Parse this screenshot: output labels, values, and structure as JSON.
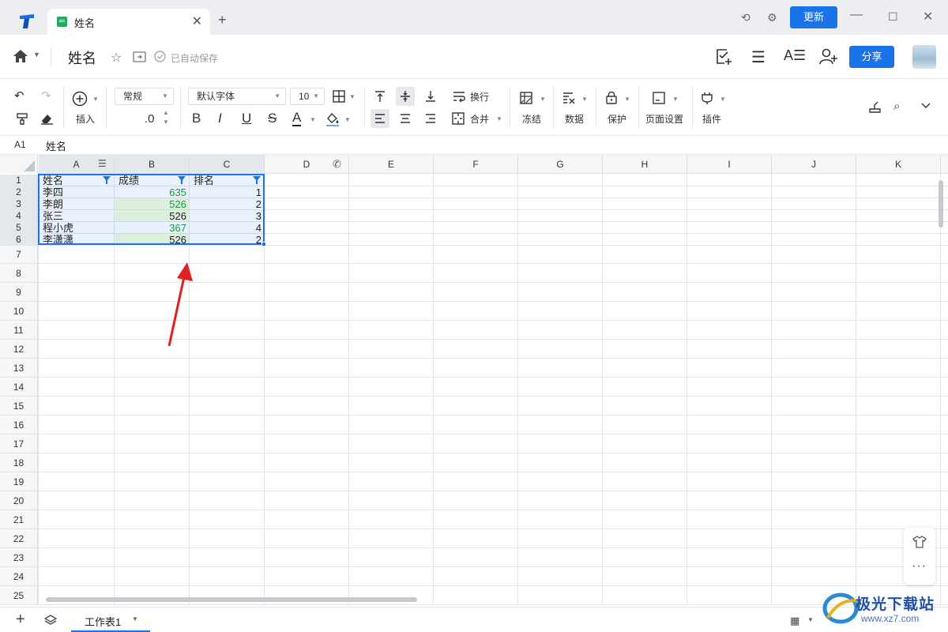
{
  "window": {
    "tab_title": "姓名",
    "update_label": "更新"
  },
  "header": {
    "doc_title": "姓名",
    "autosave": "已自动保存",
    "share_label": "分享"
  },
  "toolbar": {
    "insert_label": "插入",
    "number_format": "常规",
    "decimal_label": ".0",
    "font_name": "默认字体",
    "font_size": "10",
    "wrap_label": "换行",
    "merge_label": "合并",
    "freeze_label": "冻结",
    "data_label": "数据",
    "protect_label": "保护",
    "page_setup_label": "页面设置",
    "plugins_label": "插件",
    "bold_label": "B",
    "italic_label": "I",
    "underline_label": "U",
    "strike_label": "S",
    "font_color_label": "A"
  },
  "formula_bar": {
    "cell_ref": "A1",
    "value": "姓名"
  },
  "grid": {
    "columns": [
      "A",
      "B",
      "C",
      "D",
      "E",
      "F",
      "G",
      "H",
      "I",
      "J",
      "K"
    ],
    "rows": [
      "1",
      "2",
      "3",
      "4",
      "5",
      "6",
      "7",
      "8",
      "9",
      "10",
      "11",
      "12",
      "13",
      "14",
      "15",
      "16",
      "17",
      "18",
      "19",
      "20",
      "21",
      "22",
      "23",
      "24",
      "25"
    ],
    "table": {
      "headers": [
        "姓名",
        "成绩",
        "排名"
      ],
      "data": [
        [
          "李四",
          "635",
          "1"
        ],
        [
          "李朗",
          "526",
          "2"
        ],
        [
          "张三",
          "526",
          "3"
        ],
        [
          "程小虎",
          "367",
          "4"
        ],
        [
          "李潇潇",
          "526",
          "2"
        ]
      ],
      "highlighted_rows": [
        1,
        2,
        4
      ]
    },
    "colors": {
      "selection": "#1a73e8",
      "duplicate_fill": "#dcefdd",
      "duplicate_text": "#1a9a3a",
      "annotation_arrow": "#e02020"
    }
  },
  "sheets": {
    "active": "工作表1"
  },
  "watermark": {
    "text": "极光下载站",
    "sub": "www.xz7.com"
  },
  "icons": [
    "app-logo-icon",
    "home-icon",
    "star-icon",
    "move-icon",
    "check-circle-icon",
    "add-task-icon",
    "menu-icon",
    "text-format-icon",
    "add-user-icon",
    "undo-icon",
    "redo-icon",
    "format-painter-icon",
    "eraser-icon",
    "insert-plus-icon",
    "border-icon",
    "align-top-icon",
    "align-middle-icon",
    "align-bottom-icon",
    "wrap-icon",
    "merge-icon",
    "freeze-icon",
    "data-icon",
    "lock-icon",
    "page-setup-icon",
    "plugin-icon",
    "search-icon",
    "filter-icon",
    "phone-icon",
    "shirt-icon",
    "more-icon",
    "layers-icon",
    "grid-view-icon"
  ]
}
